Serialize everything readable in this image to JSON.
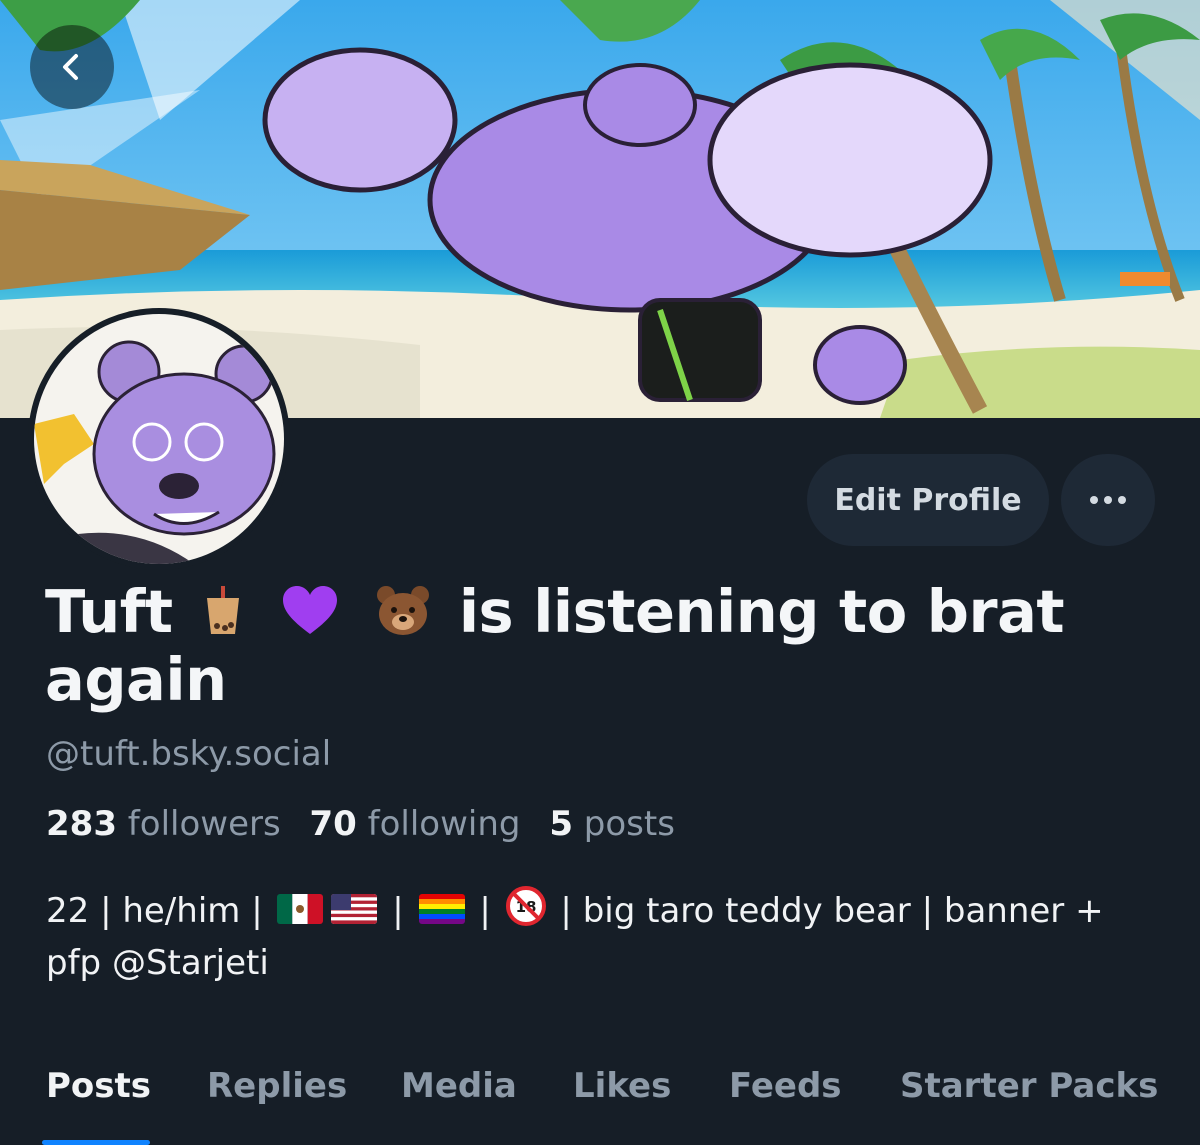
{
  "header": {
    "back_icon": "chevron-left-icon"
  },
  "actions": {
    "edit_profile": "Edit Profile",
    "more_icon": "ellipsis-icon"
  },
  "profile": {
    "name_part1": "Tuft",
    "name_emojis": [
      "bubble-tea-emoji",
      "purple-heart-emoji",
      "bear-face-emoji"
    ],
    "name_part2": "is listening to brat again",
    "handle": "@tuft.bsky.social",
    "stats": {
      "followers_count": "283",
      "followers_label": "followers",
      "following_count": "70",
      "following_label": "following",
      "posts_count": "5",
      "posts_label": "posts"
    },
    "bio": {
      "age": "22",
      "pronouns": "he/him",
      "flags": [
        "mexico-flag",
        "usa-flag"
      ],
      "pride_flag": "rainbow-flag",
      "no_minors_icon": "no-under-18-icon",
      "desc": "big taro teddy bear",
      "banner_credit": "banner",
      "pfp_credit": "+ pfp @Starjeti"
    }
  },
  "tabs": [
    {
      "label": "Posts",
      "active": true
    },
    {
      "label": "Replies"
    },
    {
      "label": "Media"
    },
    {
      "label": "Likes"
    },
    {
      "label": "Feeds"
    },
    {
      "label": "Starter Packs"
    }
  ],
  "colors": {
    "background": "#161e27",
    "button": "#1e2936",
    "muted": "#8d9aa8",
    "accent": "#1083fe"
  }
}
